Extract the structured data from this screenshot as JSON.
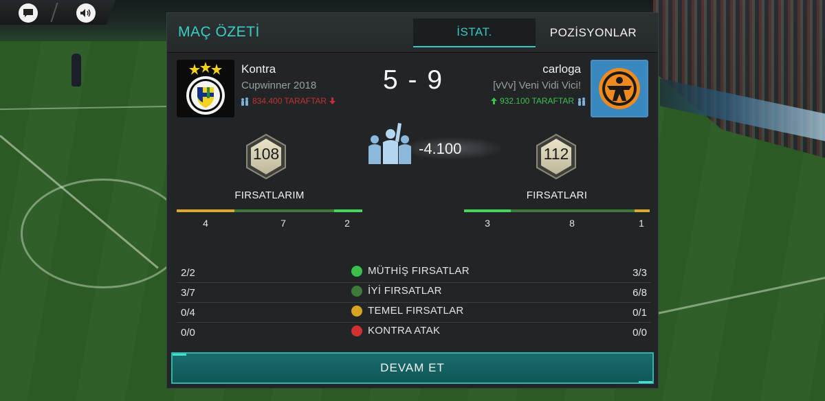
{
  "panel": {
    "title": "MAÇ ÖZETİ",
    "tabs": [
      {
        "label": "İSTAT.",
        "active": true
      },
      {
        "label": "POZİSYONLAR",
        "active": false
      }
    ]
  },
  "home": {
    "name": "Kontra",
    "subtitle": "Cupwinner 2018",
    "fans": "834.400 TARAFTAR",
    "fans_trend": "down",
    "rating": "108",
    "chances_label": "FIRSATLARIM",
    "chances_bar": [
      {
        "value": "4",
        "color": "#e0a92a",
        "share": 0.31
      },
      {
        "value": "7",
        "color": "#3e7a3a",
        "share": 0.54
      },
      {
        "value": "2",
        "color": "#45d65a",
        "share": 0.15
      }
    ]
  },
  "away": {
    "name": "carloga",
    "subtitle": "[vVv] Veni Vidi Vici!",
    "fans": "932.100 TARAFTAR",
    "fans_trend": "up",
    "rating": "112",
    "chances_label": "FIRSATLARI",
    "chances_bar": [
      {
        "value": "3",
        "color": "#45d65a",
        "share": 0.25
      },
      {
        "value": "8",
        "color": "#3e7a3a",
        "share": 0.67
      },
      {
        "value": "1",
        "color": "#e0a92a",
        "share": 0.08
      }
    ]
  },
  "score": "5 - 9",
  "fans_change": "-4.100",
  "stats": [
    {
      "label": "MÜTHİŞ FIRSATLAR",
      "home": "2/2",
      "away": "3/3",
      "ball_color": "#3bbf4a"
    },
    {
      "label": "İYİ FIRSATLAR",
      "home": "3/7",
      "away": "6/8",
      "ball_color": "#3e7a3a"
    },
    {
      "label": "TEMEL FIRSATLAR",
      "home": "0/4",
      "away": "0/1",
      "ball_color": "#d9a322"
    },
    {
      "label": "KONTRA ATAK",
      "home": "0/0",
      "away": "0/0",
      "ball_color": "#d23030"
    }
  ],
  "continue_label": "DEVAM ET",
  "colors": {
    "accent": "#36c9c0",
    "panel": "#222527",
    "fans_down": "#c83030",
    "fans_up": "#3fc04a"
  },
  "icons": {
    "chat": "chat-bubble-icon",
    "sound": "speaker-icon",
    "fans": "fans-group-icon"
  }
}
